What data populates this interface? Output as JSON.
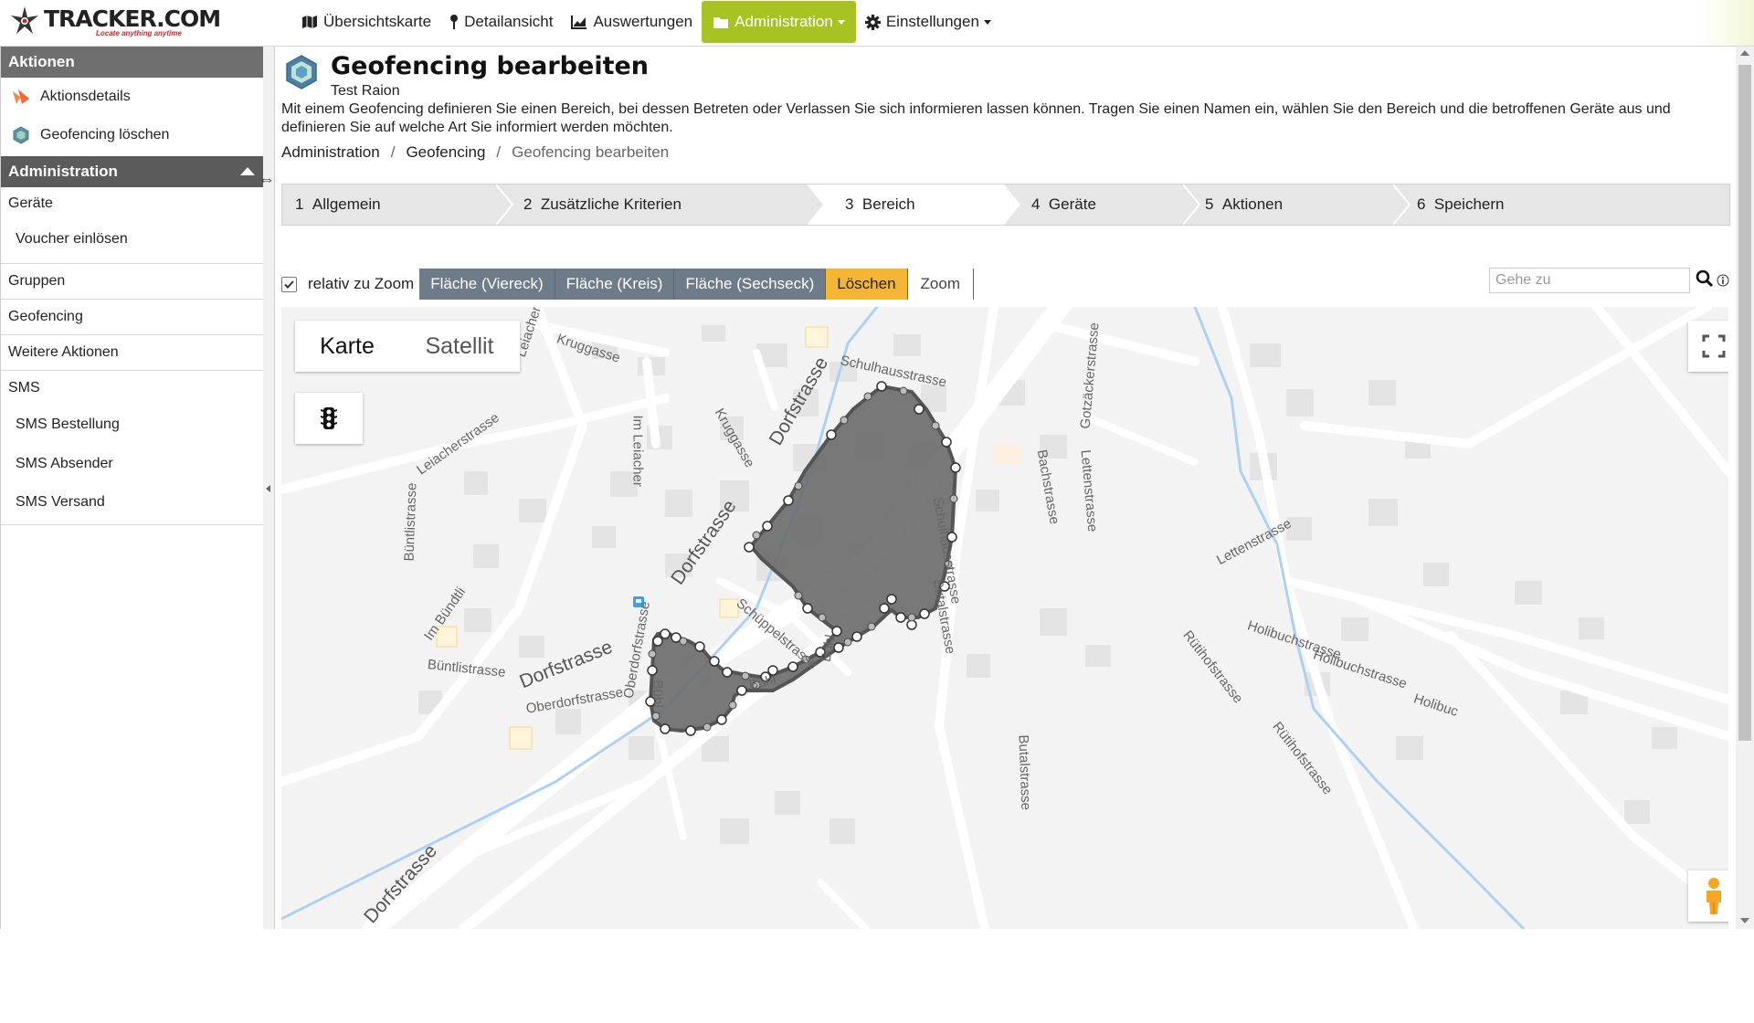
{
  "brand": {
    "name": "TRACKER.COM",
    "tagline": "Locate anything anytime"
  },
  "nav": {
    "items": [
      {
        "label": "Übersichtskarte",
        "icon": "map-icon"
      },
      {
        "label": "Detailansicht",
        "icon": "pin-icon"
      },
      {
        "label": "Auswertungen",
        "icon": "chart-icon"
      },
      {
        "label": "Administration",
        "icon": "folder-icon",
        "active": true
      },
      {
        "label": "Einstellungen",
        "icon": "gear-icon"
      }
    ]
  },
  "sidebar": {
    "aktionen_title": "Aktionen",
    "aktionen": [
      {
        "label": "Aktionsdetails"
      },
      {
        "label": "Geofencing löschen"
      }
    ],
    "admin_title": "Administration",
    "admin": [
      {
        "label": "Geräte"
      },
      {
        "label": "Voucher einlösen"
      },
      {
        "label": "Gruppen"
      },
      {
        "label": "Geofencing"
      },
      {
        "label": "Weitere Aktionen"
      },
      {
        "label": "SMS"
      },
      {
        "label": "SMS Bestellung"
      },
      {
        "label": "SMS Absender"
      },
      {
        "label": "SMS Versand"
      }
    ]
  },
  "page": {
    "title": "Geofencing bearbeiten",
    "subtitle": "Test Raion",
    "description": "Mit einem Geofencing definieren Sie einen Bereich, bei dessen Betreten oder Verlassen Sie sich informieren lassen können. Tragen Sie einen Namen ein, wählen Sie den Bereich und die betroffenen Geräte aus und definieren Sie auf welche Art Sie informiert werden möchten.",
    "breadcrumb": [
      "Administration",
      "Geofencing",
      "Geofencing bearbeiten"
    ]
  },
  "steps": [
    {
      "num": "1",
      "label": "Allgemein"
    },
    {
      "num": "2",
      "label": "Zusätzliche Kriterien"
    },
    {
      "num": "3",
      "label": "Bereich",
      "active": true
    },
    {
      "num": "4",
      "label": "Geräte"
    },
    {
      "num": "5",
      "label": "Aktionen"
    },
    {
      "num": "6",
      "label": "Speichern"
    }
  ],
  "toolbar": {
    "relative_zoom_label": "relativ zu Zoom",
    "relative_zoom_checked": true,
    "btn_square": "Fläche (Viereck)",
    "btn_circle": "Fläche (Kreis)",
    "btn_hex": "Fläche (Sechseck)",
    "btn_delete": "Löschen",
    "btn_zoom": "Zoom",
    "goto_placeholder": "Gehe zu"
  },
  "map": {
    "type_map": "Karte",
    "type_satellite": "Satellit",
    "selected_type": "Karte",
    "streets": [
      "Kruggasse",
      "Leiachers",
      "Im Leiacher",
      "Kruggasse",
      "Dorfstrasse",
      "Schulhausstrasse",
      "Leiacherstrasse",
      "Büntlistrasse",
      "Dorfstrasse",
      "Im Bündtli",
      "Büntlistrasse",
      "Dorfstrasse",
      "Oberdorfstrasse",
      "Oberdorfstrasse",
      "Schüppelstrasse",
      "Bühl",
      "Bühl",
      "Bühl",
      "Schulhausstrasse",
      "Butalstrasse",
      "Butalstrasse",
      "Bachstrasse",
      "Lettenstrasse",
      "Gotzäckerstrasse",
      "Lettenstrasse",
      "Holibuchstrasse",
      "Holibuchstrasse",
      "Holibuc",
      "Rütihofstrasse",
      "Rütihofstrasse",
      "Dorfstrasse"
    ]
  },
  "colors": {
    "accent": "#a7c322",
    "warn": "#f2b534",
    "button": "#6e7c8a",
    "sidebar_head": "#6e6e6e",
    "geofence": "#6e6e6e"
  }
}
